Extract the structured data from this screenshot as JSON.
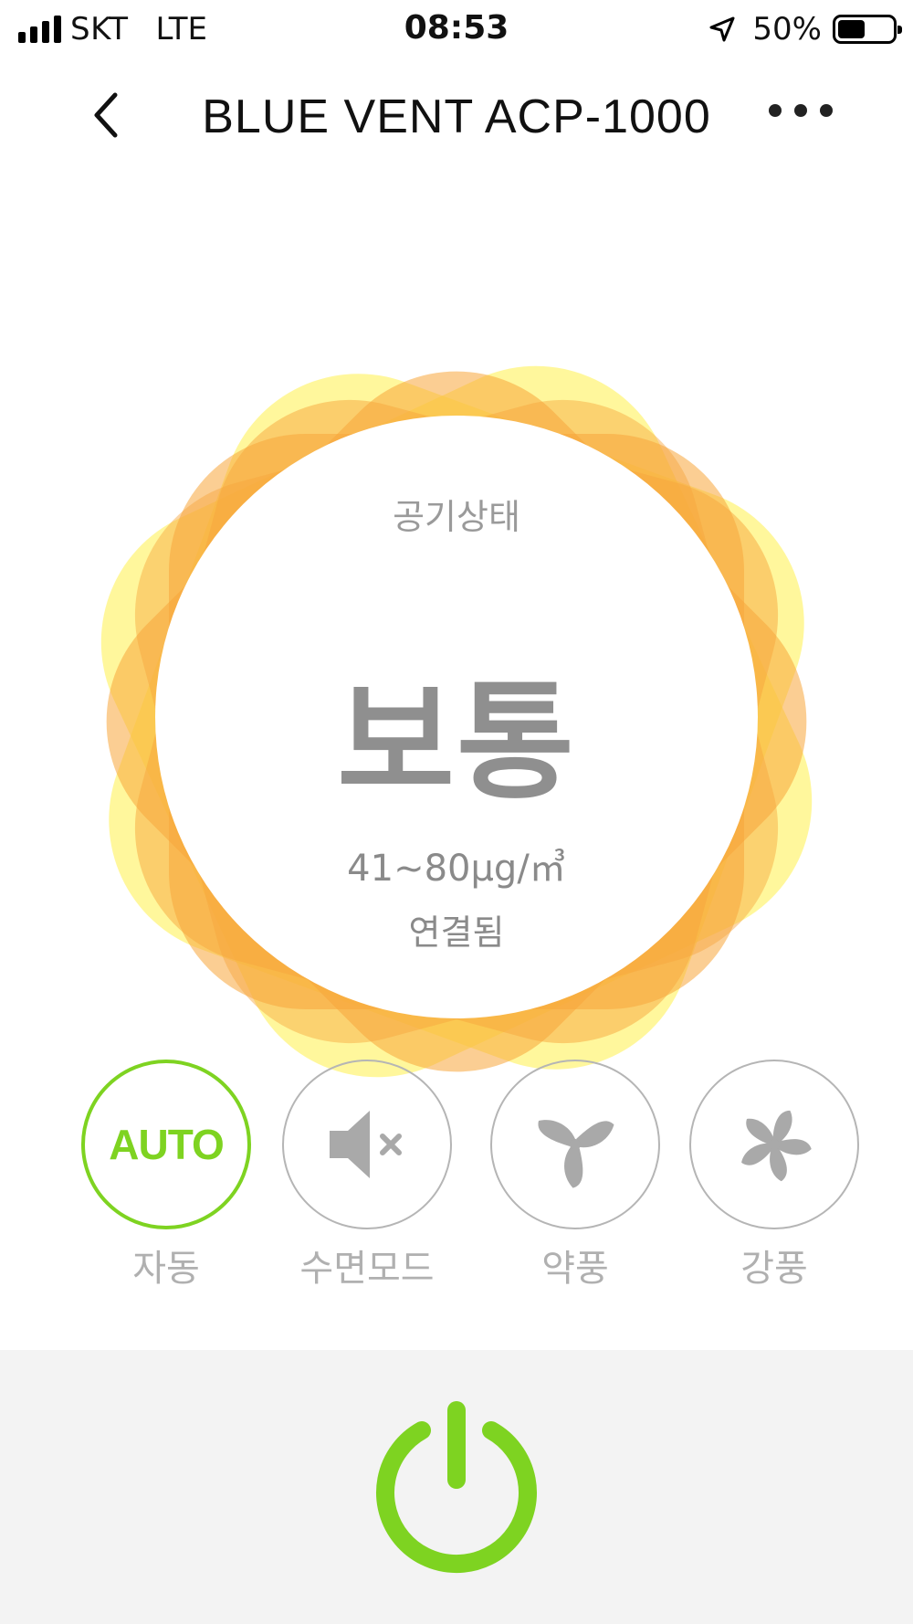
{
  "status_bar": {
    "carrier": "SKT",
    "network": "LTE",
    "time": "08:53",
    "battery_percent": "50%",
    "battery_level": 0.5,
    "icons": [
      "signal-icon",
      "location-arrow-icon",
      "battery-icon"
    ]
  },
  "nav": {
    "title": "BLUE VENT ACP-1000",
    "icons": [
      "back-chevron-icon",
      "more-dots-icon"
    ]
  },
  "air_status": {
    "label": "공기상태",
    "value": "보통",
    "range": "41~80μg/㎥",
    "connection": "연결됨",
    "colors": {
      "orange": "#F7A53B",
      "yellow": "#FFF04A"
    }
  },
  "modes": [
    {
      "key": "auto",
      "icon_text": "AUTO",
      "label": "자동",
      "active": true,
      "icon": "auto-text"
    },
    {
      "key": "sleep",
      "label": "수면모드",
      "active": false,
      "icon": "speaker-mute-icon"
    },
    {
      "key": "low",
      "label": "약풍",
      "active": false,
      "icon": "fan-three-blade-icon"
    },
    {
      "key": "high",
      "label": "강풍",
      "active": false,
      "icon": "fan-five-blade-icon"
    }
  ],
  "power": {
    "icon": "power-icon",
    "color": "#7ED321"
  },
  "colors": {
    "accent_green": "#7ED321",
    "inactive_gray": "#B0B0B0",
    "bottom_bg": "#F3F3F3"
  }
}
